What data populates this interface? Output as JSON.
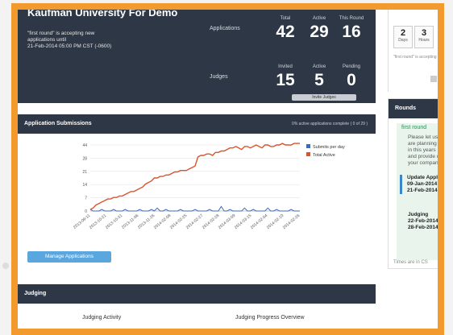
{
  "header": {
    "title": "Kaufman University For Demo",
    "note": [
      "\"first round\" is accepting new",
      "applications until",
      "21-Feb-2014 05:00 PM CST (-0600)"
    ],
    "applications_label": "Applications",
    "judges_label": "Judges",
    "app_cols": [
      {
        "label": "Total",
        "value": "42"
      },
      {
        "label": "Active",
        "value": "29"
      },
      {
        "label": "This Round",
        "value": "16"
      }
    ],
    "judge_cols": [
      {
        "label": "Invited",
        "value": "15"
      },
      {
        "label": "Active",
        "value": "5"
      },
      {
        "label": "Pending",
        "value": "0"
      }
    ],
    "judge_button": "Invite Judges"
  },
  "countdown": [
    {
      "n": "2",
      "u": "Days"
    },
    {
      "n": "3",
      "u": "Hours"
    }
  ],
  "countdown_note": "\"first round\" is accepting",
  "rounds": {
    "title": "Rounds",
    "round_name": "first round",
    "desc": [
      "Please let us",
      "are planning t",
      "in this years ",
      "and provide c",
      "your company"
    ],
    "update_label": "Update Appl",
    "update_dates": [
      "09-Jan-2014",
      "21-Feb-2014"
    ],
    "judging_label": "Judging",
    "judging_dates": [
      "22-Feb-2014",
      "28-Feb-2014"
    ],
    "footer": "Times are in CS"
  },
  "apps": {
    "title": "Application Submissions",
    "right_note": "0% active applications complete ( 0 of 29 )",
    "manage_button": "Manage Applications"
  },
  "judging": {
    "title": "Judging",
    "activity": "Judging Activity",
    "progress": "Judging Progress Overview"
  },
  "chart_data": {
    "type": "line",
    "series": [
      {
        "name": "Submits per day",
        "color": "#3b6bbf",
        "values": [
          1,
          0,
          0,
          0,
          1,
          0,
          0,
          0,
          1,
          0,
          0,
          0,
          1,
          0,
          0,
          0,
          0,
          1,
          0,
          0,
          0,
          1,
          0,
          2,
          0,
          0,
          1,
          0,
          0,
          0,
          0,
          1,
          0,
          0,
          0,
          0,
          1,
          0,
          0,
          0,
          0,
          1,
          0,
          0,
          0,
          3,
          0,
          0,
          1,
          0,
          0,
          0,
          0,
          2,
          0,
          0,
          1,
          0,
          0,
          0,
          0,
          2,
          0,
          0,
          1,
          0,
          0,
          0,
          0,
          1,
          0,
          0,
          0
        ]
      },
      {
        "name": "Total Active",
        "color": "#d9552e",
        "values": [
          1,
          2,
          4,
          5,
          6,
          7,
          8,
          8,
          9,
          9,
          10,
          10,
          11,
          12,
          13,
          13,
          14,
          15,
          16,
          18,
          19,
          20,
          22,
          22,
          23,
          23,
          24,
          24,
          25,
          26,
          26,
          27,
          27,
          27,
          28,
          29,
          30,
          36,
          37,
          37,
          38,
          38,
          37,
          39,
          39,
          40,
          40,
          41,
          42,
          42,
          43,
          42,
          41,
          43,
          43,
          42,
          43,
          44,
          43,
          42,
          44,
          44,
          43,
          43,
          44,
          44,
          45,
          44,
          44,
          44,
          45,
          45,
          45
        ]
      }
    ],
    "yticks": [
      "0",
      "7",
      "14",
      "21",
      "28",
      "44"
    ],
    "xticks": [
      "2013-09-11",
      "2013-10-21",
      "2013-10-31",
      "2013-11-06",
      "2013-11-26",
      "2014-02-08",
      "2014-02-25",
      "2014-02-27",
      "2014-02-28",
      "2014-03-09",
      "2014-03-15",
      "2014-02-04",
      "2014-02-10",
      "2014-02-26"
    ],
    "ylim": [
      0,
      44
    ]
  }
}
